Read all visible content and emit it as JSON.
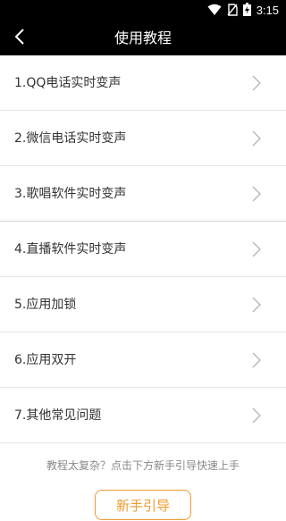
{
  "status_bar": {
    "time": "3:15",
    "icons": [
      "wifi-icon",
      "no-sim-icon",
      "battery-charging-icon"
    ]
  },
  "header": {
    "title": "使用教程",
    "back_icon": "chevron-left-icon"
  },
  "tutorials": [
    {
      "label": "1.QQ电话实时变声"
    },
    {
      "label": "2.微信电话实时变声"
    },
    {
      "label": "3.歌唱软件实时变声"
    },
    {
      "label": "4.直播软件实时变声"
    },
    {
      "label": "5.应用加锁"
    },
    {
      "label": "6.应用双开"
    },
    {
      "label": "7.其他常见问题"
    }
  ],
  "footer": {
    "hint": "教程太复杂？点击下方新手引导快速上手",
    "guide_button": "新手引导",
    "accent_color": "#f29a2e"
  }
}
